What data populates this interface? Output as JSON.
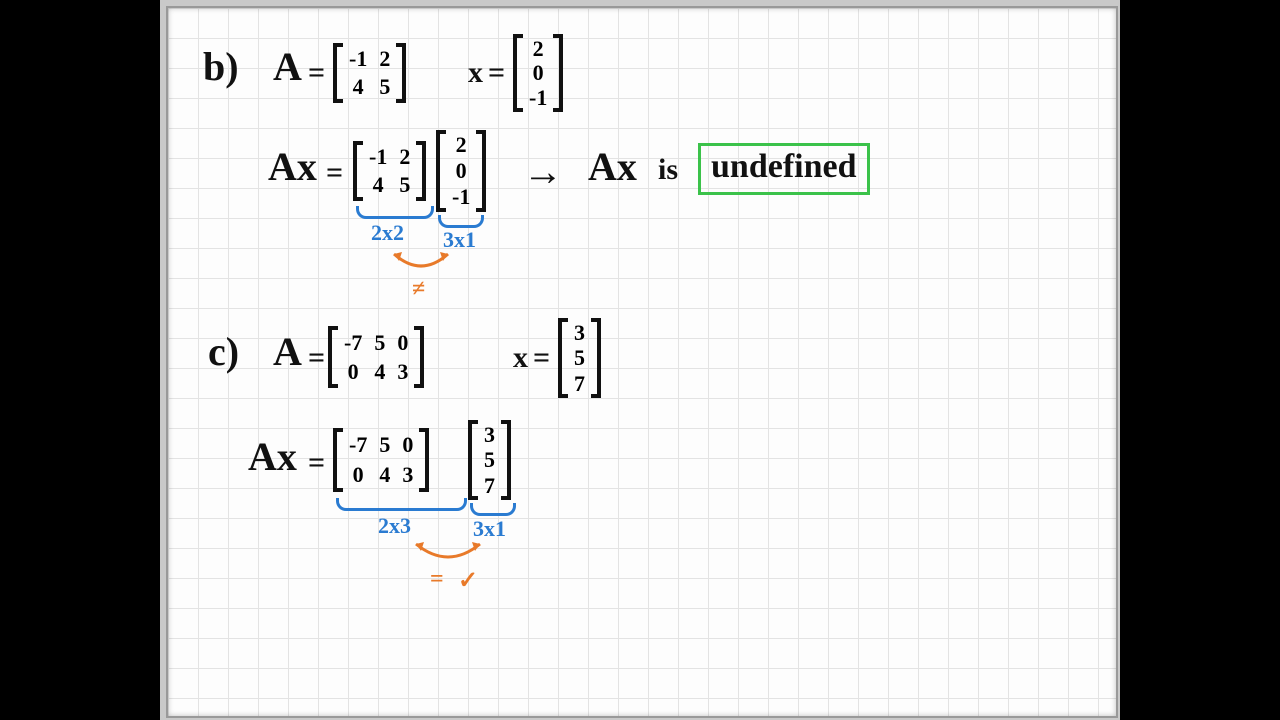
{
  "problemB": {
    "label": "b)",
    "A_name": "A",
    "x_name": "x",
    "eq": "=",
    "A": [
      [
        "-1",
        "2"
      ],
      [
        "4",
        "5"
      ]
    ],
    "x": [
      [
        "2"
      ],
      [
        "0"
      ],
      [
        "-1"
      ]
    ],
    "Ax_label": "Ax",
    "dimA": "2x2",
    "dimX": "3x1",
    "cmp": "≠",
    "arrow": "→",
    "result_prefix": "Ax",
    "is_word": "is",
    "result": "undefined"
  },
  "problemC": {
    "label": "c)",
    "A_name": "A",
    "x_name": "x",
    "eq": "=",
    "A": [
      [
        "-7",
        "5",
        "0"
      ],
      [
        "0",
        "4",
        "3"
      ]
    ],
    "x": [
      [
        "3"
      ],
      [
        "5"
      ],
      [
        "7"
      ]
    ],
    "Ax_label": "Ax",
    "dimA": "2x3",
    "dimX": "3x1",
    "cmp": "=",
    "check": "✓"
  }
}
